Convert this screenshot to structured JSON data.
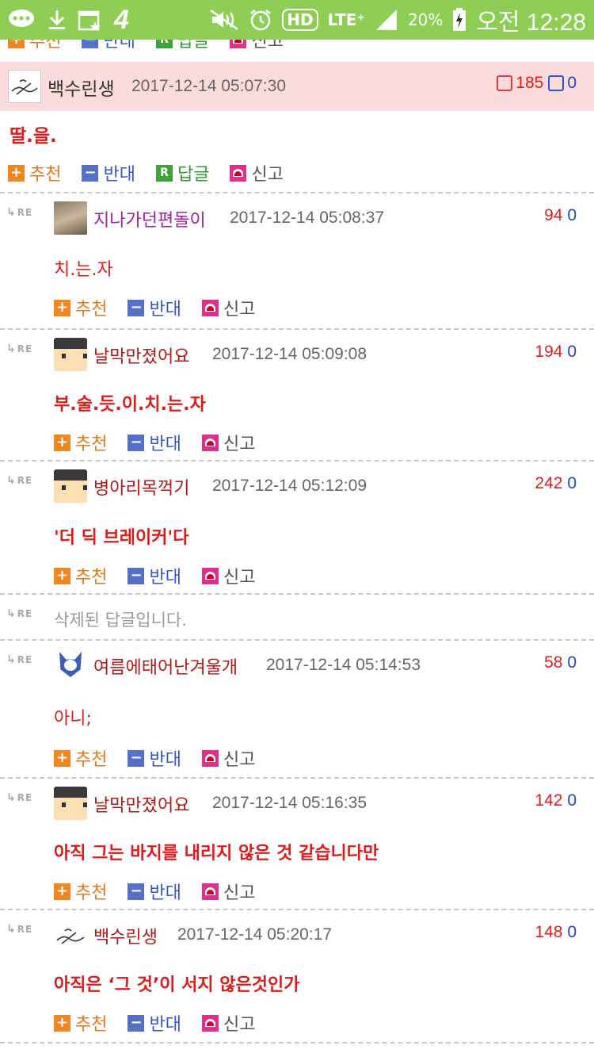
{
  "statusbar": {
    "left_icons": [
      "message-icon",
      "download-icon",
      "calendar-icon",
      "signal-4g-icon"
    ],
    "carrier_digit": "4",
    "right": {
      "mute": "mute-icon",
      "alarm": "alarm-icon",
      "hd": "HD",
      "lte": "LTE⁺",
      "battery_percent": "20%",
      "time": "오전 12:28"
    }
  },
  "labels": {
    "recommend": "추천",
    "oppose": "반대",
    "reply": "답글",
    "report": "신고",
    "re": "RE"
  },
  "post": {
    "nick": "백수린생",
    "date": "2017-12-14 05:07:30",
    "up": "185",
    "down": "0",
    "body": "딸.을."
  },
  "comments": [
    {
      "nick": "지나가던편돌이",
      "nick_color": "#a020a0",
      "date": "2017-12-14 05:08:37",
      "up": "94",
      "down": "0",
      "body": "치.는.자",
      "bold": false
    },
    {
      "nick": "날막만졌어요",
      "nick_color": "#b01818",
      "date": "2017-12-14 05:09:08",
      "up": "194",
      "down": "0",
      "body": "부.술.듯.이.치.는.자",
      "bold": true
    },
    {
      "nick": "병아리목꺽기",
      "nick_color": "#b01818",
      "date": "2017-12-14 05:12:09",
      "up": "242",
      "down": "0",
      "body": "'더 딕 브레이커'다",
      "bold": true
    },
    {
      "deleted": "삭제된 답글입니다."
    },
    {
      "nick": "여름에태어난겨울개",
      "nick_color": "#b01818",
      "date": "2017-12-14 05:14:53",
      "up": "58",
      "down": "0",
      "body": "아니;",
      "bold": false
    },
    {
      "nick": "날막만졌어요",
      "nick_color": "#b01818",
      "date": "2017-12-14 05:16:35",
      "up": "142",
      "down": "0",
      "body": "아직 그는 바지를 내리지 않은 것 같습니다만",
      "bold": true
    },
    {
      "nick": "백수린생",
      "nick_color": "#b01818",
      "date": "2017-12-14 05:20:17",
      "up": "148",
      "down": "0",
      "body": "아직은 ‘그 것’이 서지 않은것인가",
      "bold": true
    }
  ]
}
